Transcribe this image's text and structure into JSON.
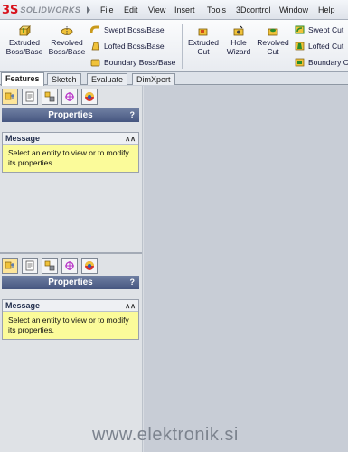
{
  "app": {
    "logo_text": "SOLIDWORKS"
  },
  "menu": [
    "File",
    "Edit",
    "View",
    "Insert",
    "Tools",
    "3Dcontrol",
    "Window",
    "Help"
  ],
  "commands": {
    "big": [
      {
        "label_line1": "Extruded",
        "label_line2": "Boss/Base",
        "icon": "extruded-boss-icon"
      },
      {
        "label_line1": "Revolved",
        "label_line2": "Boss/Base",
        "icon": "revolved-boss-icon"
      },
      {
        "label_line1": "Extruded",
        "label_line2": "Cut",
        "icon": "extruded-cut-icon"
      },
      {
        "label_line1": "Hole",
        "label_line2": "Wizard",
        "icon": "hole-wizard-icon"
      },
      {
        "label_line1": "Revolved",
        "label_line2": "Cut",
        "icon": "revolved-cut-icon"
      }
    ],
    "small": [
      {
        "label": "Swept Boss/Base",
        "icon": "swept-boss-icon"
      },
      {
        "label": "Lofted Boss/Base",
        "icon": "lofted-boss-icon"
      },
      {
        "label": "Boundary Boss/Base",
        "icon": "boundary-boss-icon"
      },
      {
        "label": "Swept Cut",
        "icon": "swept-cut-icon"
      },
      {
        "label": "Lofted Cut",
        "icon": "lofted-cut-icon"
      },
      {
        "label": "Boundary C",
        "icon": "boundary-cut-icon"
      }
    ]
  },
  "tabs": [
    "Features",
    "Sketch",
    "Evaluate",
    "DimXpert"
  ],
  "panel_top": {
    "title": "Properties",
    "help": "?",
    "message_title": "Message",
    "message_text": "Select an entity to view or to modify its properties."
  },
  "panel_bottom": {
    "title": "Properties",
    "help": "?",
    "message_title": "Message",
    "message_text": "Select an entity to view or to modify its properties."
  },
  "watermark": "www.elektronik.si"
}
